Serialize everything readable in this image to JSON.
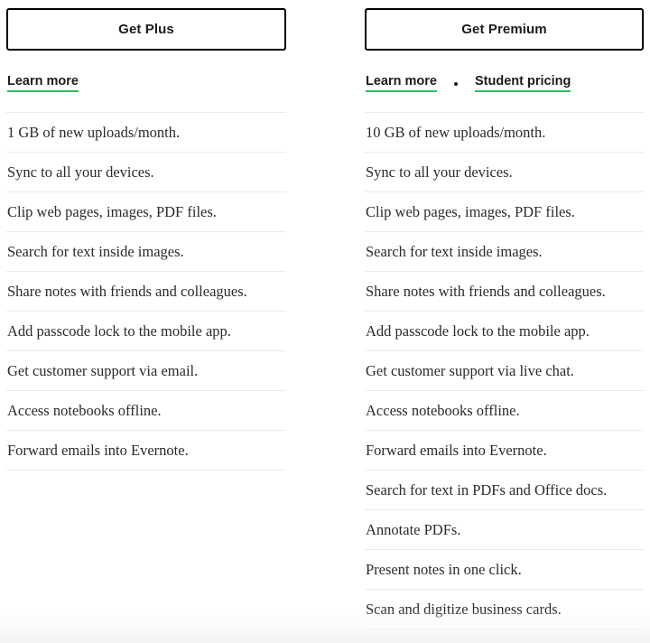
{
  "colors": {
    "accent_green": "#2dbe60",
    "button_border": "#000000",
    "divider": "#ebebeb",
    "text": "#2b2b2b",
    "page_background": "#ffffff"
  },
  "plans": [
    {
      "id": "plus",
      "cta_label": "Get Plus",
      "links": [
        {
          "label": "Learn more",
          "name": "learn-more-link"
        }
      ],
      "separator": "",
      "features": [
        "1 GB of new uploads/month.",
        "Sync to all your devices.",
        "Clip web pages, images, PDF files.",
        "Search for text inside images.",
        "Share notes with friends and colleagues.",
        "Add passcode lock to the mobile app.",
        "Get customer support via email.",
        "Access notebooks offline.",
        "Forward emails into Evernote."
      ]
    },
    {
      "id": "premium",
      "cta_label": "Get Premium",
      "links": [
        {
          "label": "Learn more",
          "name": "learn-more-link"
        },
        {
          "label": "Student pricing",
          "name": "student-pricing-link"
        }
      ],
      "separator": "•",
      "features": [
        "10 GB of new uploads/month.",
        "Sync to all your devices.",
        "Clip web pages, images, PDF files.",
        "Search for text inside images.",
        "Share notes with friends and colleagues.",
        "Add passcode lock to the mobile app.",
        "Get customer support via live chat.",
        "Access notebooks offline.",
        "Forward emails into Evernote.",
        "Search for text in PDFs and Office docs.",
        "Annotate PDFs.",
        "Present notes in one click.",
        "Scan and digitize business cards."
      ]
    }
  ]
}
